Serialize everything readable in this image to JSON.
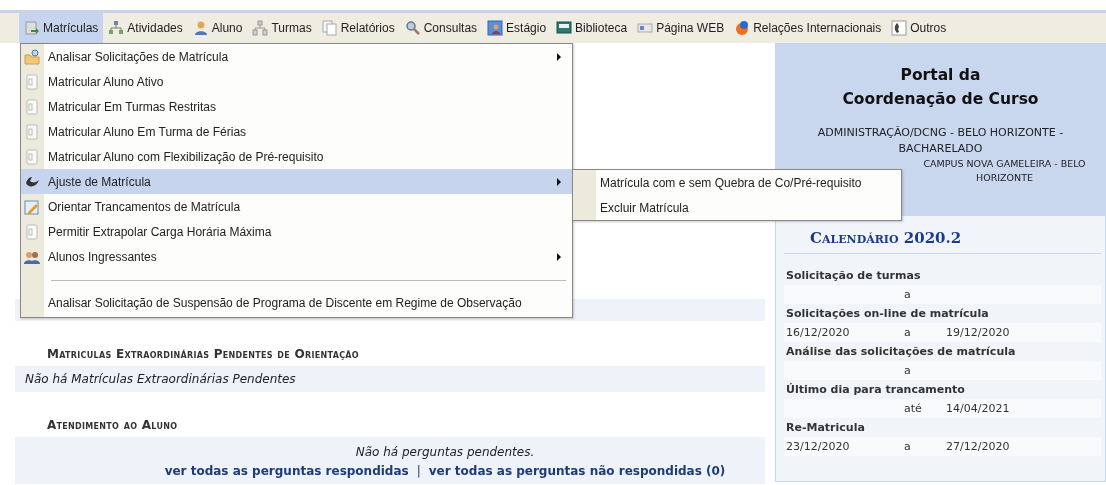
{
  "menubar": {
    "items": [
      {
        "label": "Matrículas",
        "selected": true
      },
      {
        "label": "Atividades",
        "selected": false
      },
      {
        "label": "Aluno",
        "selected": false
      },
      {
        "label": "Turmas",
        "selected": false
      },
      {
        "label": "Relatórios",
        "selected": false
      },
      {
        "label": "Consultas",
        "selected": false
      },
      {
        "label": "Estágio",
        "selected": false
      },
      {
        "label": "Biblioteca",
        "selected": false
      },
      {
        "label": "Página WEB",
        "selected": false
      },
      {
        "label": "Relações Internacionais",
        "selected": false
      },
      {
        "label": "Outros",
        "selected": false
      }
    ]
  },
  "dropdown": {
    "items": [
      {
        "kind": "item",
        "label": "Analisar Solicitações de Matrícula",
        "has_submenu": true,
        "selected": false
      },
      {
        "kind": "item",
        "label": "Matricular Aluno Ativo",
        "has_submenu": false,
        "selected": false
      },
      {
        "kind": "item",
        "label": "Matricular Em Turmas Restritas",
        "has_submenu": false,
        "selected": false
      },
      {
        "kind": "item",
        "label": "Matricular Aluno Em Turma de Férias",
        "has_submenu": false,
        "selected": false
      },
      {
        "kind": "item",
        "label": "Matricular Aluno com Flexibilização de Pré-requisito",
        "has_submenu": false,
        "selected": false
      },
      {
        "kind": "item",
        "label": "Ajuste de Matrícula",
        "has_submenu": true,
        "selected": true
      },
      {
        "kind": "item",
        "label": "Orientar Trancamentos de Matrícula",
        "has_submenu": false,
        "selected": false
      },
      {
        "kind": "item",
        "label": "Permitir Extrapolar Carga Horária Máxima",
        "has_submenu": false,
        "selected": false
      },
      {
        "kind": "item",
        "label": "Alunos Ingressantes",
        "has_submenu": true,
        "selected": false
      },
      {
        "kind": "separator"
      },
      {
        "kind": "item",
        "label": "Analisar Solicitação de Suspensão de Programa de Discente em Regime de Observação",
        "has_submenu": false,
        "selected": false
      }
    ]
  },
  "submenu": {
    "items": [
      {
        "label": "Matrícula com e sem Quebra de Co/Pré-requisito"
      },
      {
        "label": "Excluir Matrícula"
      }
    ]
  },
  "sections": [
    {
      "kind": "message",
      "title": "Matriculas Extraordinárias Pendentes de Orientação",
      "message": "Não há Matrículas Extraordinárias Pendentes"
    },
    {
      "kind": "questions",
      "title": "Atendimento ao Aluno",
      "message": "Não há perguntas pendentes.",
      "links": [
        "ver todas as perguntas respondidas",
        "ver todas as perguntas não respondidas (0)"
      ],
      "link_separator": "|"
    }
  ],
  "portal": {
    "title_lines": [
      "Portal da",
      "Coordenação de Curso"
    ],
    "course": "ADMINISTRAÇÃO/DCNG - BELO HORIZONTE - BACHARELADO",
    "campus": "CAMPUS NOVA GAMELEIRA - BELO HORIZONTE",
    "calendar": {
      "title": "Calendário 2020.2",
      "rows": [
        {
          "label": "Solicitação de turmas",
          "separator": "a"
        },
        {
          "label": "Solicitações on-line de matrícula",
          "start": "16/12/2020",
          "separator": "a",
          "end": "19/12/2020"
        },
        {
          "label": "Análise das solicitações de matrícula",
          "separator": "a"
        },
        {
          "label": "Último dia para trancamento",
          "separator": "até",
          "end": "14/04/2021"
        },
        {
          "label": "Re-Matricula",
          "start": "23/12/2020",
          "separator": "a",
          "end": "27/12/2020"
        }
      ]
    }
  }
}
